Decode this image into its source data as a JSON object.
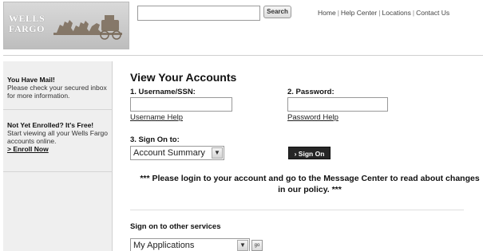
{
  "brand": {
    "logo_text": "WELLS\nFARGO"
  },
  "header": {
    "search_placeholder": "",
    "search_button": "Search",
    "links": [
      "Home",
      "Help Center",
      "Locations",
      "Contact Us"
    ],
    "separator": "|"
  },
  "sidebar": {
    "mail": {
      "title": "You Have Mail!",
      "body": "Please check your secured inbox for more information."
    },
    "enroll": {
      "title": "Not Yet Enrolled? It's Free!",
      "body": "Start viewing all your Wells Fargo accounts online.",
      "link": "> Enroll Now"
    }
  },
  "main": {
    "title": "View Your Accounts",
    "username_label": "1. Username/SSN:",
    "password_label": "2. Password:",
    "username_help": "Username Help",
    "password_help": "Password Help",
    "signon_label": "3. Sign On to:",
    "signon_select": "Account Summary",
    "signon_button": "› Sign On",
    "notice": "*** Please login to your account and go to the Message Center to read about changes in our policy. ***",
    "other_label": "Sign on to other services",
    "other_select": "My Applications",
    "go_button": "go"
  }
}
